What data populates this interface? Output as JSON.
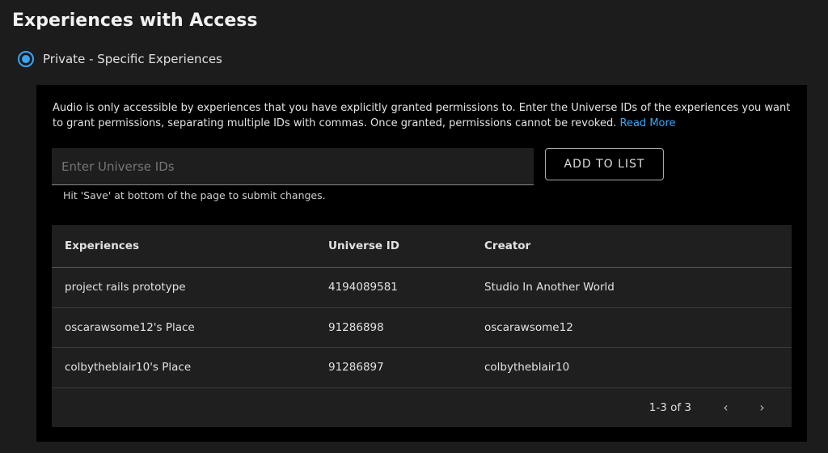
{
  "title": "Experiences with Access",
  "access_option": "Private - Specific Experiences",
  "description": "Audio is only accessible by experiences that you have explicitly granted permissions to. Enter the Universe IDs of the experiences you want to grant permissions, separating multiple IDs with commas. Once granted, permissions cannot be revoked.",
  "read_more": "Read More",
  "input_placeholder": "Enter Universe IDs",
  "add_button": "ADD TO LIST",
  "hint": "Hit 'Save' at bottom of the page to submit changes.",
  "table": {
    "headers": [
      "Experiences",
      "Universe ID",
      "Creator"
    ],
    "rows": [
      [
        "project rails prototype",
        "4194089581",
        "Studio In Another World"
      ],
      [
        "oscarawsome12's Place",
        "91286898",
        "oscarawsome12"
      ],
      [
        "colbytheblair10's Place",
        "91286897",
        "colbytheblair10"
      ]
    ]
  },
  "pagination": {
    "label": "1-3 of 3",
    "prev": "‹",
    "next": "›"
  },
  "accent": "#3ba4f5"
}
